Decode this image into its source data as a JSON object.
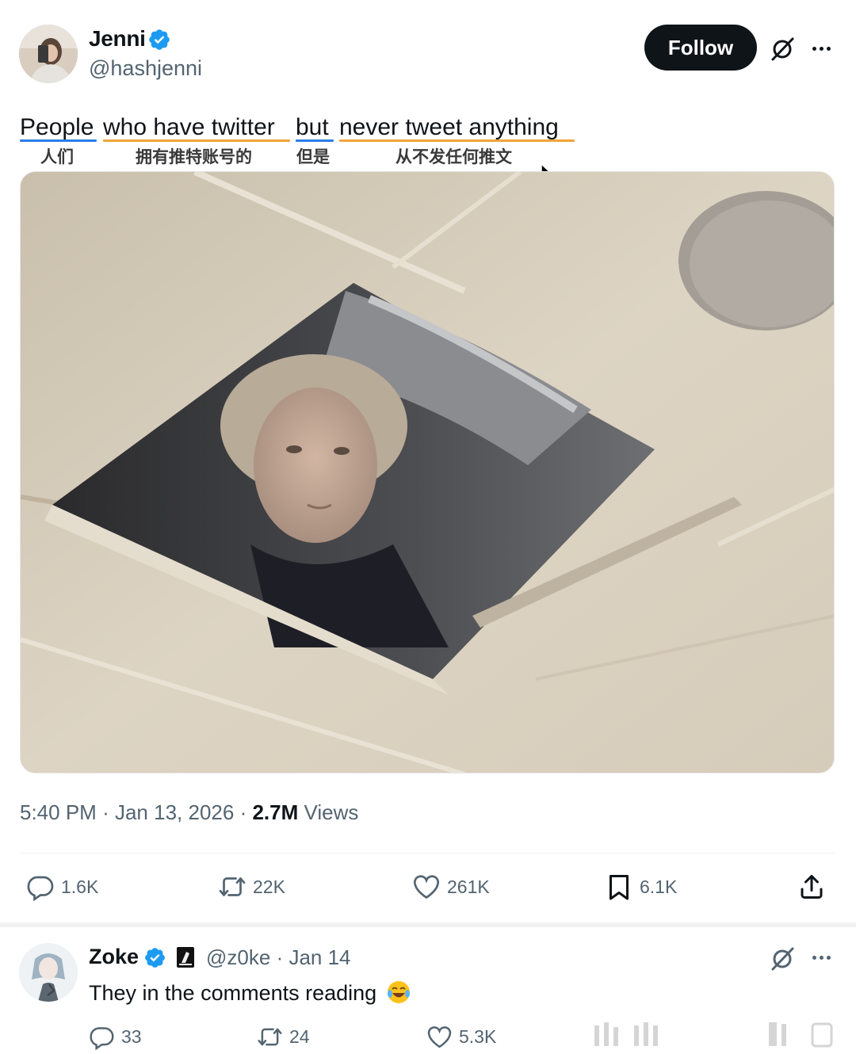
{
  "tweet": {
    "author": {
      "name": "Jenni",
      "handle": "@hashjenni",
      "verified": true
    },
    "follow_label": "Follow",
    "text_segments": [
      {
        "text": "People",
        "translation": "人们",
        "color": "#2b7de9"
      },
      {
        "text": "who have twitter",
        "translation": "拥有推特账号的",
        "color": "#f0a43a"
      },
      {
        "text": "but",
        "translation": "但是",
        "color": "#2b7de9"
      },
      {
        "text": "never tweet anything",
        "translation": "从不发任何推文",
        "color": "#f0a43a"
      }
    ],
    "time": "5:40 PM",
    "date": "Jan 13, 2026",
    "views_count": "2.7M",
    "views_label": "Views",
    "actions": {
      "replies": "1.6K",
      "reposts": "22K",
      "likes": "261K",
      "bookmarks": "6.1K"
    }
  },
  "reply": {
    "name": "Zoke",
    "verified": true,
    "handle": "@z0ke",
    "date": "Jan 14",
    "text": "They in the comments reading",
    "emoji": "😂",
    "actions": {
      "replies": "33",
      "reposts": "24",
      "likes": "5.3K"
    }
  },
  "colors": {
    "verified_blue": "#1d9bf0",
    "follow_bg": "#0f1419",
    "muted_text": "#536471"
  },
  "icons": [
    "verified-badge-icon",
    "grok-icon",
    "more-icon",
    "reply-icon",
    "repost-icon",
    "like-icon",
    "bookmark-icon",
    "share-icon",
    "cursor-icon"
  ]
}
